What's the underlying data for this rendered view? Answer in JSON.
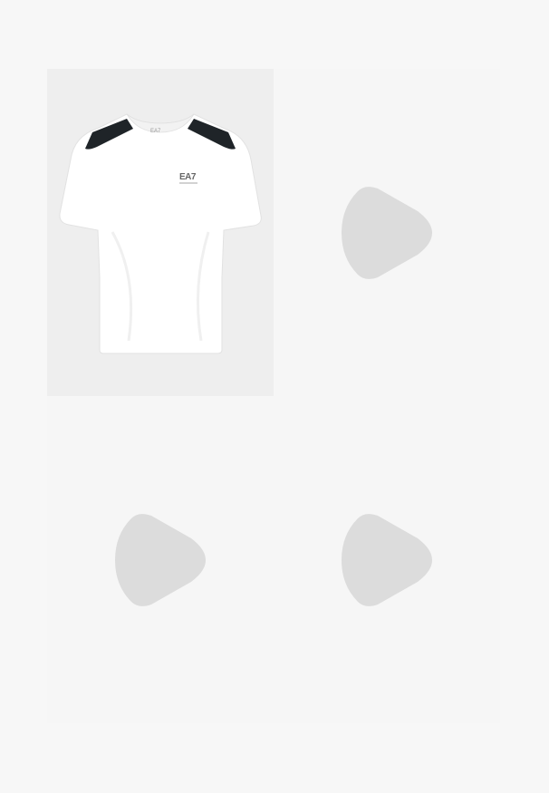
{
  "gallery": {
    "product_image": {
      "icon": "white-tshirt-with-black-shoulder-stripes",
      "brand_mark": "EA7",
      "collar_mark": "EA7",
      "colors": {
        "shirt": "#ffffff",
        "stripe": "#1f2428",
        "background": "#eeeeee"
      }
    },
    "placeholders": [
      {
        "icon": "play-triangle-icon",
        "color": "#dcdcdc"
      },
      {
        "icon": "play-triangle-icon",
        "color": "#dcdcdc"
      },
      {
        "icon": "play-triangle-icon",
        "color": "#dcdcdc"
      }
    ]
  },
  "colors": {
    "page_background": "#f7f7f7",
    "tile_background": "#f6f6f6"
  }
}
